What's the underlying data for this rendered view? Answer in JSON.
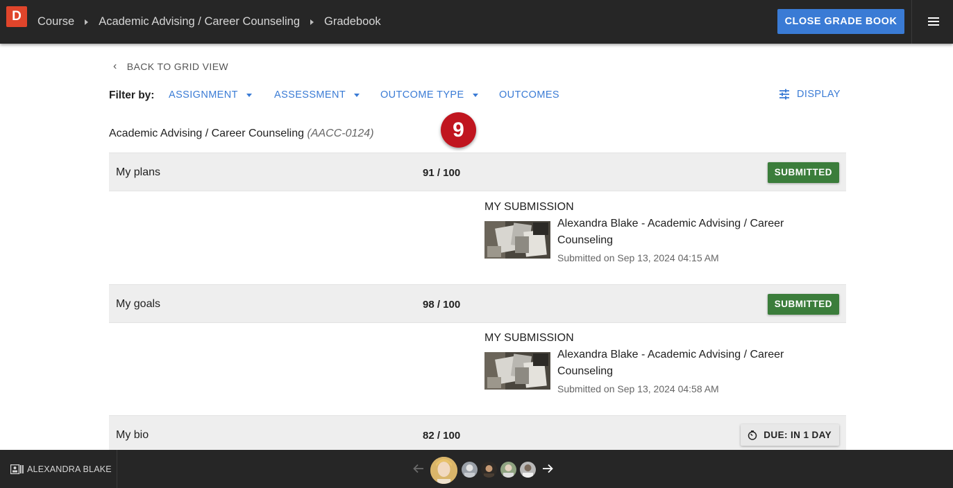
{
  "header": {
    "logo_letter": "D",
    "breadcrumbs": [
      "Course",
      "Academic Advising / Career Counseling",
      "Gradebook"
    ],
    "close_button": "CLOSE GRADE BOOK"
  },
  "back_link": "BACK TO GRID VIEW",
  "filters": {
    "label": "Filter by:",
    "items": [
      "ASSIGNMENT",
      "ASSESSMENT",
      "OUTCOME TYPE",
      "OUTCOMES"
    ],
    "display": "DISPLAY"
  },
  "step_badge": "9",
  "course": {
    "name": "Academic Advising / Career Counseling",
    "code": "(AACC-0124)"
  },
  "assignments": [
    {
      "name": "My plans",
      "score": "91 / 100",
      "status": "SUBMITTED",
      "submission": {
        "heading": "MY SUBMISSION",
        "title": "Alexandra Blake - Academic Advising / Career Counseling",
        "date": "Submitted on Sep 13, 2024 04:15 AM"
      }
    },
    {
      "name": "My goals",
      "score": "98 / 100",
      "status": "SUBMITTED",
      "submission": {
        "heading": "MY SUBMISSION",
        "title": "Alexandra Blake - Academic Advising / Career Counseling",
        "date": "Submitted on Sep 13, 2024 04:58 AM"
      }
    },
    {
      "name": "My bio",
      "score": "82 / 100",
      "status": "DUE: IN 1 DAY"
    }
  ],
  "footer": {
    "student_name": "ALEXANDRA BLAKE"
  },
  "colors": {
    "accent": "#3a7bd5",
    "submitted": "#3b7d3b",
    "badge": "#c0151f",
    "bar": "#262626"
  }
}
